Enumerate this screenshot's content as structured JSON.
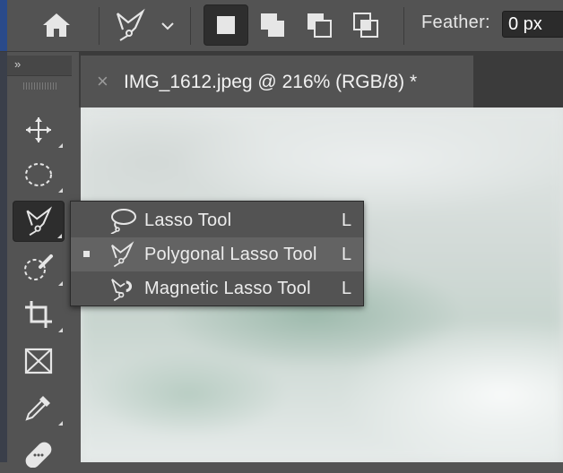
{
  "options_bar": {
    "feather_label": "Feather:",
    "feather_value": "0 px",
    "icons": [
      "home-icon",
      "polygonal-lasso-preset-icon",
      "chevron-down-icon",
      "new-selection-icon",
      "add-to-selection-icon",
      "subtract-from-selection-icon",
      "intersect-selection-icon"
    ]
  },
  "toolbar": {
    "collapse_label": "»",
    "tools": [
      "move-tool",
      "elliptical-marquee-tool",
      "polygonal-lasso-tool",
      "quick-selection-tool",
      "crop-tool",
      "frame-tool",
      "eyedropper-tool",
      "spot-healing-brush-tool"
    ],
    "active_tool": "polygonal-lasso-tool"
  },
  "document_tab": {
    "close_glyph": "×",
    "title": "IMG_1612.jpeg @ 216% (RGB/8) *"
  },
  "flyout": {
    "items": [
      {
        "label": "Lasso Tool",
        "shortcut": "L",
        "selected": false
      },
      {
        "label": "Polygonal Lasso Tool",
        "shortcut": "L",
        "selected": true
      },
      {
        "label": "Magnetic Lasso Tool",
        "shortcut": "L",
        "selected": false
      }
    ]
  },
  "colors": {
    "panel": "#535353",
    "dark_panel": "#3b3b3b",
    "text": "#e6e6e6"
  }
}
